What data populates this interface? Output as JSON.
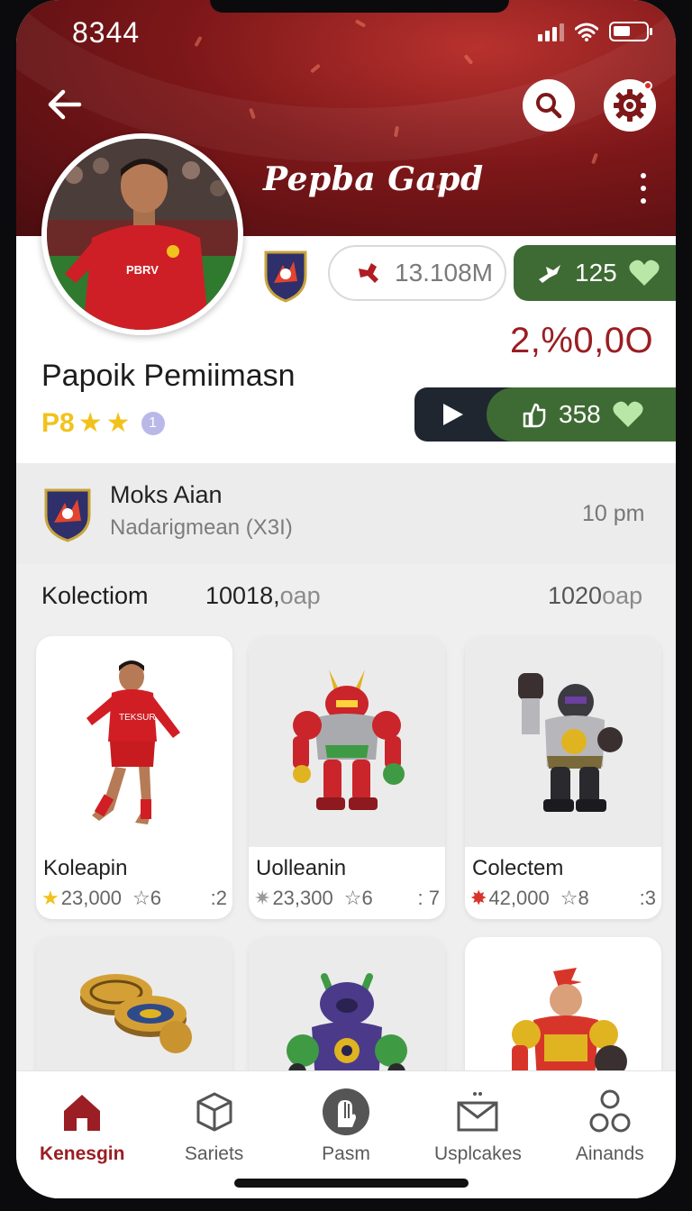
{
  "status_bar": {
    "time": "8344"
  },
  "header": {
    "title": "Pepba Gapd"
  },
  "profile": {
    "name": "Papoik Pemiimasn",
    "rating_code": "P8",
    "level_badge": "1",
    "stat_value": "13.108M",
    "likes_a": "125",
    "big_value": "2,%0,0O",
    "likes_b": "358"
  },
  "activity": {
    "title": "Moks Aian",
    "subtitle": "Nadarigmean (X3I)",
    "time": "10 pm"
  },
  "collection": {
    "title": "Kolectiom",
    "total_value": "10018,",
    "total_unit": "oap",
    "right_value": "1020",
    "right_unit": "oap",
    "items": [
      {
        "name": "Koleapin",
        "value": "23,000",
        "rating": "☆6",
        "count": ":2",
        "icon": "gold-star-icon"
      },
      {
        "name": "Uolleanin",
        "value": "23,300",
        "rating": "☆6",
        "count": ": 7",
        "icon": "sparkle-icon"
      },
      {
        "name": "Colectem",
        "value": "42,000",
        "rating": "☆8",
        "count": ":3",
        "icon": "burst-icon"
      },
      {
        "name": "",
        "value": "",
        "rating": "",
        "count": "",
        "icon": "coins-image"
      },
      {
        "name": "",
        "value": "",
        "rating": "",
        "count": "",
        "icon": "purple-robot-image"
      },
      {
        "name": "",
        "value": "",
        "rating": "",
        "count": "",
        "icon": "red-gold-robot-image"
      }
    ]
  },
  "bottom_nav": [
    {
      "label": "Kenesgin",
      "icon": "home-icon",
      "active": true
    },
    {
      "label": "Sariets",
      "icon": "cube-icon",
      "active": false
    },
    {
      "label": "Pasm",
      "icon": "hand-icon",
      "active": false
    },
    {
      "label": "Usplcakes",
      "icon": "mail-icon",
      "active": false
    },
    {
      "label": "Ainands",
      "icon": "circles-icon",
      "active": false
    }
  ],
  "colors": {
    "brand_red": "#9a1e23",
    "green": "#3e6b33",
    "star_gold": "#f2c21c",
    "dark": "#1f2630"
  }
}
